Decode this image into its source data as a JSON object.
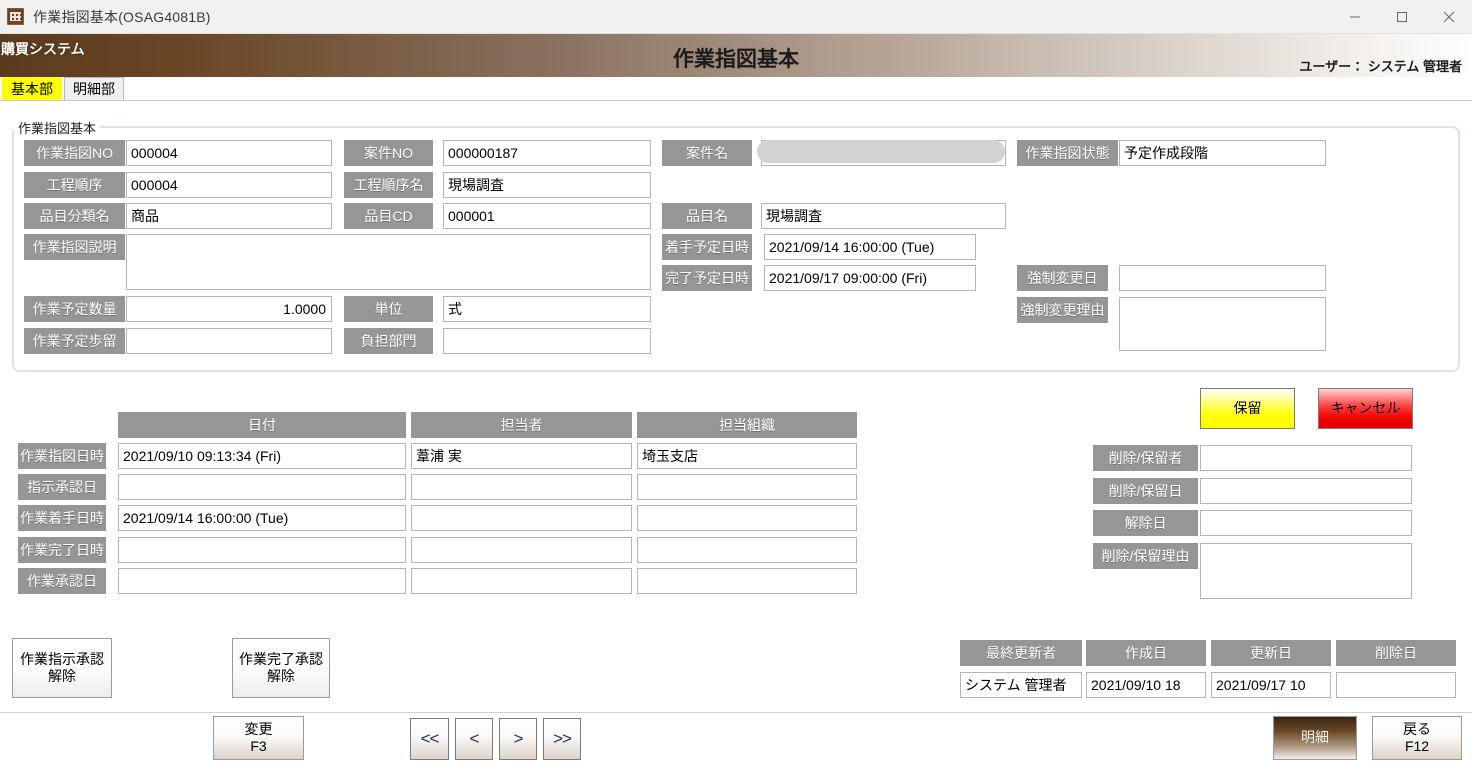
{
  "window": {
    "title": "作業指図基本(OSAG4081B)",
    "icon": "app-icon",
    "controls": {
      "minimize": "minimize-icon",
      "maximize": "maximize-icon",
      "close": "close-icon"
    }
  },
  "banner": {
    "system_name": "購買システム",
    "title": "作業指図基本",
    "user_label": "ユーザー：",
    "user_name": "システム 管理者"
  },
  "tabs": [
    {
      "label": "基本部",
      "active": true
    },
    {
      "label": "明細部",
      "active": false
    }
  ],
  "panel": {
    "legend": "作業指図基本",
    "fields": {
      "work_order_no": {
        "label": "作業指図NO",
        "value": "000004"
      },
      "case_no": {
        "label": "案件NO",
        "value": "000000187"
      },
      "case_name": {
        "label": "案件名",
        "value": "",
        "redacted": true
      },
      "work_order_status": {
        "label": "作業指図状態",
        "value": "予定作成段階"
      },
      "process_seq": {
        "label": "工程順序",
        "value": "000004"
      },
      "process_seq_name": {
        "label": "工程順序名",
        "value": "現場調査"
      },
      "item_class_name": {
        "label": "品目分類名",
        "value": "商品"
      },
      "item_cd": {
        "label": "品目CD",
        "value": "000001"
      },
      "item_name": {
        "label": "品目名",
        "value": "現場調査"
      },
      "work_order_desc": {
        "label": "作業指図説明",
        "value": ""
      },
      "planned_start": {
        "label": "着手予定日時",
        "value": "2021/09/14 16:00:00 (Tue)"
      },
      "planned_end": {
        "label": "完了予定日時",
        "value": "2021/09/17 09:00:00 (Fri)"
      },
      "forced_change_date": {
        "label": "強制変更日",
        "value": ""
      },
      "forced_change_reason": {
        "label": "強制変更理由",
        "value": ""
      },
      "planned_qty": {
        "label": "作業予定数量",
        "value": "1.0000"
      },
      "unit": {
        "label": "単位",
        "value": "式"
      },
      "planned_yield": {
        "label": "作業予定歩留",
        "value": ""
      },
      "charge_dept": {
        "label": "負担部門",
        "value": ""
      }
    }
  },
  "grid": {
    "columns": [
      "日付",
      "担当者",
      "担当組織"
    ],
    "rows": [
      {
        "label": "作業指図日時",
        "date": "2021/09/10 09:13:34 (Fri)",
        "person": "葦浦 実",
        "org": "埼玉支店"
      },
      {
        "label": "指示承認日",
        "date": "",
        "person": "",
        "org": ""
      },
      {
        "label": "作業着手日時",
        "date": "2021/09/14 16:00:00 (Tue)",
        "person": "",
        "org": ""
      },
      {
        "label": "作業完了日時",
        "date": "",
        "person": "",
        "org": ""
      },
      {
        "label": "作業承認日",
        "date": "",
        "person": "",
        "org": ""
      }
    ]
  },
  "side": {
    "hold_button": "保留",
    "cancel_button": "キャンセル",
    "fields": {
      "delete_hold_person": {
        "label": "削除/保留者",
        "value": ""
      },
      "delete_hold_date": {
        "label": "削除/保留日",
        "value": ""
      },
      "release_date": {
        "label": "解除日",
        "value": ""
      },
      "delete_hold_reason": {
        "label": "削除/保留理由",
        "value": ""
      }
    }
  },
  "approval_buttons": {
    "instruction_release": {
      "line1": "作業指示承認",
      "line2": "解除"
    },
    "completion_release": {
      "line1": "作業完了承認",
      "line2": "解除"
    }
  },
  "audit": {
    "columns": [
      "最終更新者",
      "作成日",
      "更新日",
      "削除日"
    ],
    "values": [
      "システム 管理者",
      "2021/09/10 18",
      "2021/09/17 10",
      ""
    ]
  },
  "footer": {
    "change_button": {
      "line1": "変更",
      "line2": "F3"
    },
    "nav": [
      {
        "label": "<<",
        "name": "nav-first"
      },
      {
        "label": "<",
        "name": "nav-prev"
      },
      {
        "label": ">",
        "name": "nav-next"
      },
      {
        "label": ">>",
        "name": "nav-last"
      }
    ],
    "detail_button": "明細",
    "back_button": {
      "line1": "戻る",
      "line2": "F12"
    }
  }
}
